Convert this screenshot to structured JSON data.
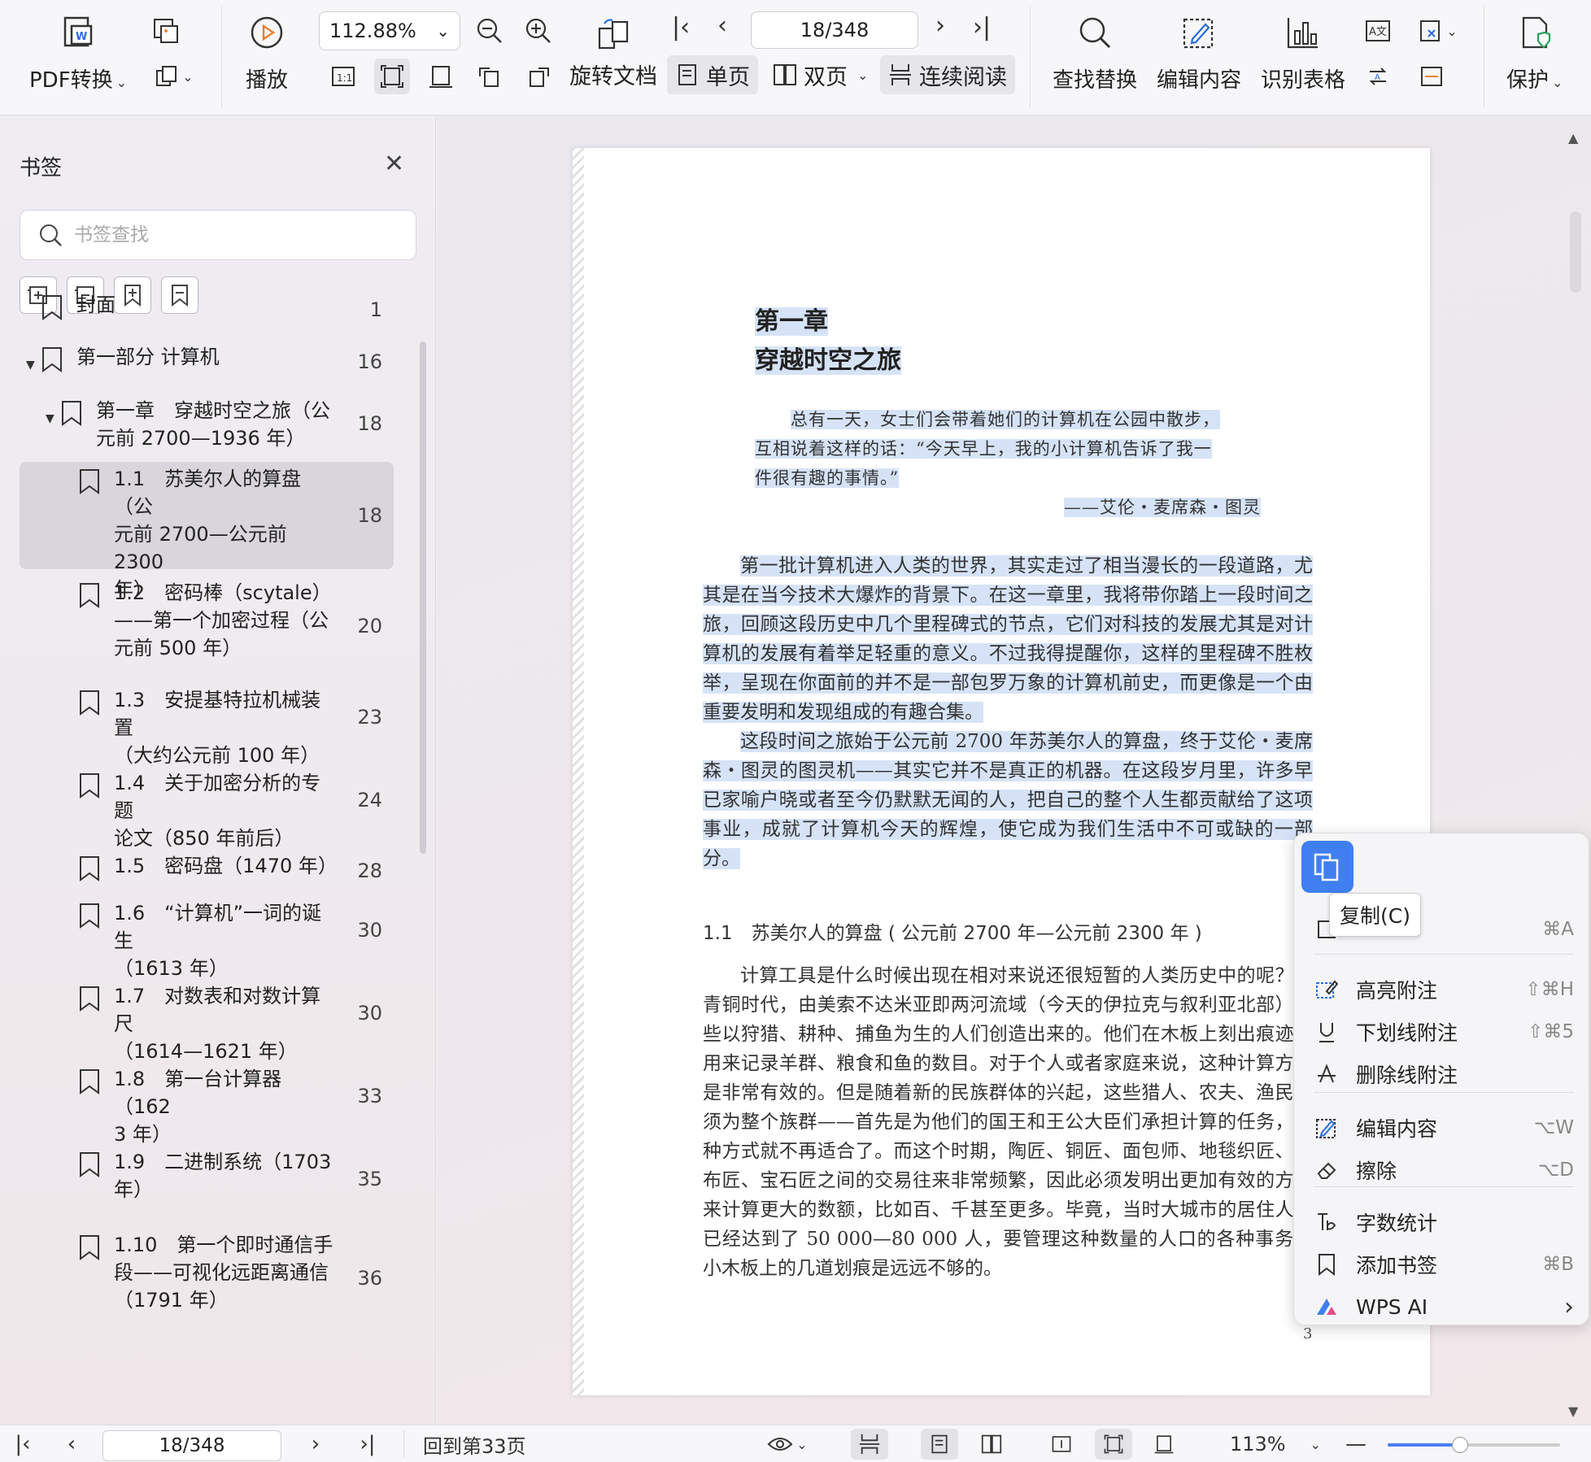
{
  "toolbar": {
    "pdf_convert": "PDF转换",
    "play": "播放",
    "zoom_value": "112.88%",
    "rotate_doc": "旋转文档",
    "page_indicator": "18/348",
    "single_page": "单页",
    "double_page": "双页",
    "continuous": "连续阅读",
    "find_replace": "查找替换",
    "edit_content": "编辑内容",
    "recognize_table": "识别表格",
    "protect": "保护"
  },
  "sidebar": {
    "title": "书签",
    "search_placeholder": "书签查找",
    "items": [
      {
        "label": "封面",
        "page": "1"
      },
      {
        "label": "第一部分 计算机",
        "page": "16"
      },
      {
        "label": "第一章　穿越时空之旅（公\n元前 2700—1936 年）",
        "page": "18"
      },
      {
        "label": "1.1　苏美尔人的算盘（公\n元前 2700—公元前 2300\n年）",
        "page": "18"
      },
      {
        "label": "1.2　密码棒（scytale）\n——第一个加密过程（公\n元前 500 年）",
        "page": "20"
      },
      {
        "label": "1.3　安提基特拉机械装置\n（大约公元前 100 年）",
        "page": "23"
      },
      {
        "label": "1.4　关于加密分析的专题\n论文（850 年前后）",
        "page": "24"
      },
      {
        "label": "1.5　密码盘（1470 年）",
        "page": "28"
      },
      {
        "label": "1.6　“计算机”一词的诞生\n（1613 年）",
        "page": "30"
      },
      {
        "label": "1.7　对数表和对数计算尺\n（1614—1621 年）",
        "page": "30"
      },
      {
        "label": "1.8　第一台计算器（162\n3 年）",
        "page": "33"
      },
      {
        "label": "1.9　二进制系统（1703\n年）",
        "page": "35"
      },
      {
        "label": "1.10　第一个即时通信手\n段——可视化远距离通信\n（1791 年）",
        "page": "36"
      }
    ]
  },
  "document": {
    "chapter": "第一章",
    "chapter_title": "穿越时空之旅",
    "quote_lines": [
      "总有一天，女士们会带着她们的计算机在公园中散步，",
      "互相说着这样的话：“今天早上，我的小计算机告诉了我一",
      "件很有趣的事情。”"
    ],
    "quote_author": "——艾伦・麦席森・图灵",
    "para1": "第一批计算机进入人类的世界，其实走过了相当漫长的一段道路，尤其是在当今技术大爆炸的背景下。在这一章里，我将带你踏上一段时间之旅，回顾这段历史中几个里程碑式的节点，它们对科技的发展尤其是对计算机的发展有着举足轻重的意义。不过我得提醒你，这样的里程碑不胜枚举，呈现在你面前的并不是一部包罗万象的计算机前史，而更像是一个由重要发明和发现组成的有趣合集。",
    "para2": "这段时间之旅始于公元前 2700 年苏美尔人的算盘，终于艾伦・麦席森・图灵的图灵机——其实它并不是真正的机器。在这段岁月里，许多早已家喻户晓或者至今仍默默无闻的人，把自己的整个人生都贡献给了这项事业，成就了计算机今天的辉煌，使它成为我们生活中不可或缺的一部分。",
    "section": "1.1　苏美尔人的算盘 ( 公元前 2700 年—公元前 2300 年 )",
    "para3": "计算工具是什么时候出现在相对来说还很短暂的人类历史中的呢？是青铜时代，由美索不达米亚即两河流域（今天的伊拉克与叙利亚北部）那些以狩猎、耕种、捕鱼为生的人们创造出来的。他们在木板上刻出痕迹，用来记录羊群、粮食和鱼的数目。对于个人或者家庭来说，这种计算方法是非常有效的。但是随着新的民族群体的兴起，这些猎人、农夫、渔民必须为整个族群——首先是为他们的国王和王公大臣们承担计算的任务，这种方式就不再适合了。而这个时期，陶匠、铜匠、面包师、地毯织匠、织布匠、宝石匠之间的交易往来非常频繁，因此必须发明出更加有效的方法来计算更大的数额，比如百、千甚至更多。毕竟，当时大城市的居住人口已经达到了 50 000—80 000 人，要管理这种数量的人口的各种事务，小木板上的几道划痕是远远不够的。",
    "page_number": "3"
  },
  "context_menu": {
    "tooltip": "复制(C)",
    "select_all_shortcut": "⌘A",
    "items": [
      {
        "label": "高亮附注",
        "shortcut": "⇧⌘H"
      },
      {
        "label": "下划线附注",
        "shortcut": "⇧⌘5"
      },
      {
        "label": "删除线附注",
        "shortcut": ""
      },
      {
        "label": "编辑内容",
        "shortcut": "⌥W"
      },
      {
        "label": "擦除",
        "shortcut": "⌥D"
      },
      {
        "label": "字数统计",
        "shortcut": ""
      },
      {
        "label": "添加书签",
        "shortcut": "⌘B"
      },
      {
        "label": "WPS AI",
        "shortcut": "›"
      }
    ]
  },
  "status": {
    "page": "18/348",
    "back_to": "回到第33页",
    "zoom": "113%",
    "zoom_fraction": 0.42
  }
}
